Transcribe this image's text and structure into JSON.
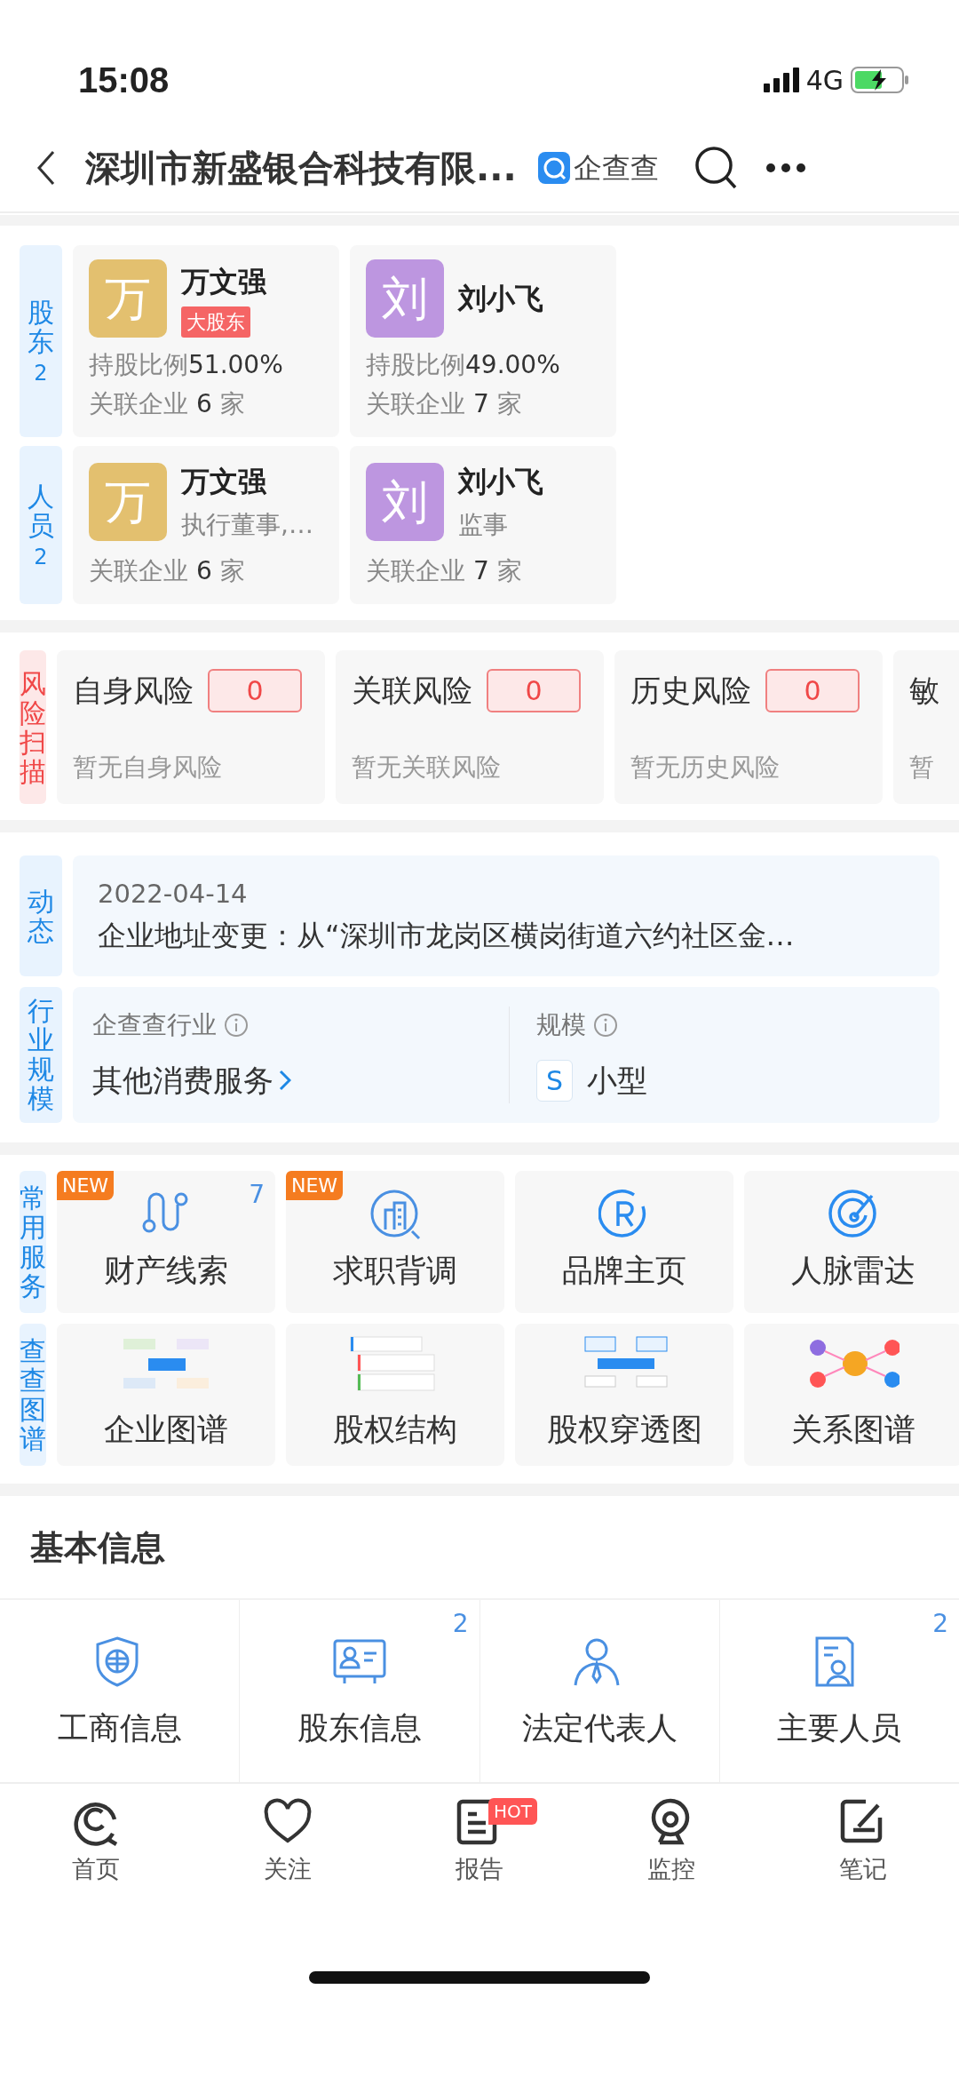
{
  "status_bar": {
    "time": "15:08",
    "network": "4G"
  },
  "header": {
    "title": "深圳市新盛银合科技有限...",
    "brand": "企查查"
  },
  "shareholders": {
    "label": "股东",
    "count": "2",
    "items": [
      {
        "avatar": "万",
        "color": "#e3c06f",
        "name": "万文强",
        "tag": "大股东",
        "share_label": "持股比例",
        "share": "51.00%",
        "related_label": "关联企业",
        "related": "6",
        "unit": "家"
      },
      {
        "avatar": "刘",
        "color": "#bd96e0",
        "name": "刘小飞",
        "share_label": "持股比例",
        "share": "49.00%",
        "related_label": "关联企业",
        "related": "7",
        "unit": "家"
      }
    ]
  },
  "people": {
    "label": "人员",
    "count": "2",
    "items": [
      {
        "avatar": "万",
        "color": "#e3c06f",
        "name": "万文强",
        "role": "执行董事,…",
        "related_label": "关联企业",
        "related": "6",
        "unit": "家"
      },
      {
        "avatar": "刘",
        "color": "#bd96e0",
        "name": "刘小飞",
        "role": "监事",
        "related_label": "关联企业",
        "related": "7",
        "unit": "家"
      }
    ]
  },
  "risk": {
    "label": "风险扫描",
    "items": [
      {
        "title": "自身风险",
        "count": "0",
        "note": "暂无自身风险"
      },
      {
        "title": "关联风险",
        "count": "0",
        "note": "暂无关联风险"
      },
      {
        "title": "历史风险",
        "count": "0",
        "note": "暂无历史风险"
      },
      {
        "title": "敏",
        "note": "暂"
      }
    ]
  },
  "dynamics": {
    "label": "动态",
    "date": "2022-04-14",
    "text": "企业地址变更：从“深圳市龙岗区横岗街道六约社区金…"
  },
  "industry": {
    "label": "行业规模",
    "industry_label": "企查查行业",
    "industry_value": "其他消费服务",
    "scale_label": "规模",
    "scale_badge": "S",
    "scale_value": "小型"
  },
  "services": {
    "label": "常用服务",
    "items": [
      {
        "label": "财产线索",
        "badge": "NEW",
        "count": "7"
      },
      {
        "label": "求职背调",
        "badge": "NEW"
      },
      {
        "label": "品牌主页"
      },
      {
        "label": "人脉雷达"
      }
    ]
  },
  "graphs": {
    "label": "查查图谱",
    "items": [
      {
        "label": "企业图谱"
      },
      {
        "label": "股权结构"
      },
      {
        "label": "股权穿透图"
      },
      {
        "label": "关系图谱"
      }
    ]
  },
  "basic_info": {
    "title": "基本信息",
    "items": [
      {
        "label": "工商信息"
      },
      {
        "label": "股东信息",
        "count": "2"
      },
      {
        "label": "法定代表人"
      },
      {
        "label": "主要人员",
        "count": "2"
      }
    ]
  },
  "tab_bar": {
    "items": [
      {
        "label": "首页"
      },
      {
        "label": "关注"
      },
      {
        "label": "报告",
        "badge": "HOT"
      },
      {
        "label": "监控"
      },
      {
        "label": "笔记"
      }
    ]
  }
}
